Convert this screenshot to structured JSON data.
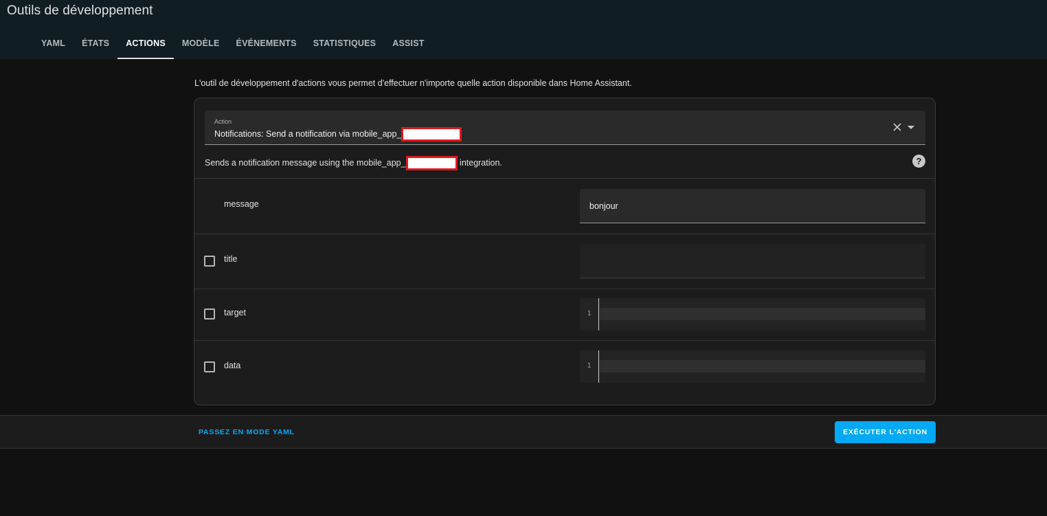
{
  "header": {
    "title": "Outils de développement",
    "tabs": [
      {
        "label": "YAML"
      },
      {
        "label": "ÉTATS"
      },
      {
        "label": "ACTIONS"
      },
      {
        "label": "MODÈLE"
      },
      {
        "label": "ÉVÉNEMENTS"
      },
      {
        "label": "STATISTIQUES"
      },
      {
        "label": "ASSIST"
      }
    ],
    "active_tab": "ACTIONS"
  },
  "intro_text": "L'outil de développement d'actions vous permet d'effectuer n'importe quelle action disponible dans Home Assistant.",
  "action_select": {
    "label": "Action",
    "value_prefix": "Notifications: Send a notification via mobile_app_"
  },
  "description": {
    "prefix": "Sends a notification message using the mobile_app_",
    "suffix": " integration."
  },
  "fields": {
    "message": {
      "label": "message",
      "value": "bonjour"
    },
    "title": {
      "label": "title",
      "value": ""
    },
    "target": {
      "label": "target",
      "line_number": "1"
    },
    "data": {
      "label": "data",
      "line_number": "1"
    }
  },
  "footer": {
    "yaml_mode_label": "PASSEZ EN MODE YAML",
    "run_label": "EXÉCUTER L'ACTION"
  },
  "colors": {
    "accent": "#03a9f4",
    "header_bg": "#101e24",
    "redaction": "#e0181f"
  },
  "icons": [
    "close-icon",
    "dropdown-arrow-icon",
    "help-icon"
  ]
}
